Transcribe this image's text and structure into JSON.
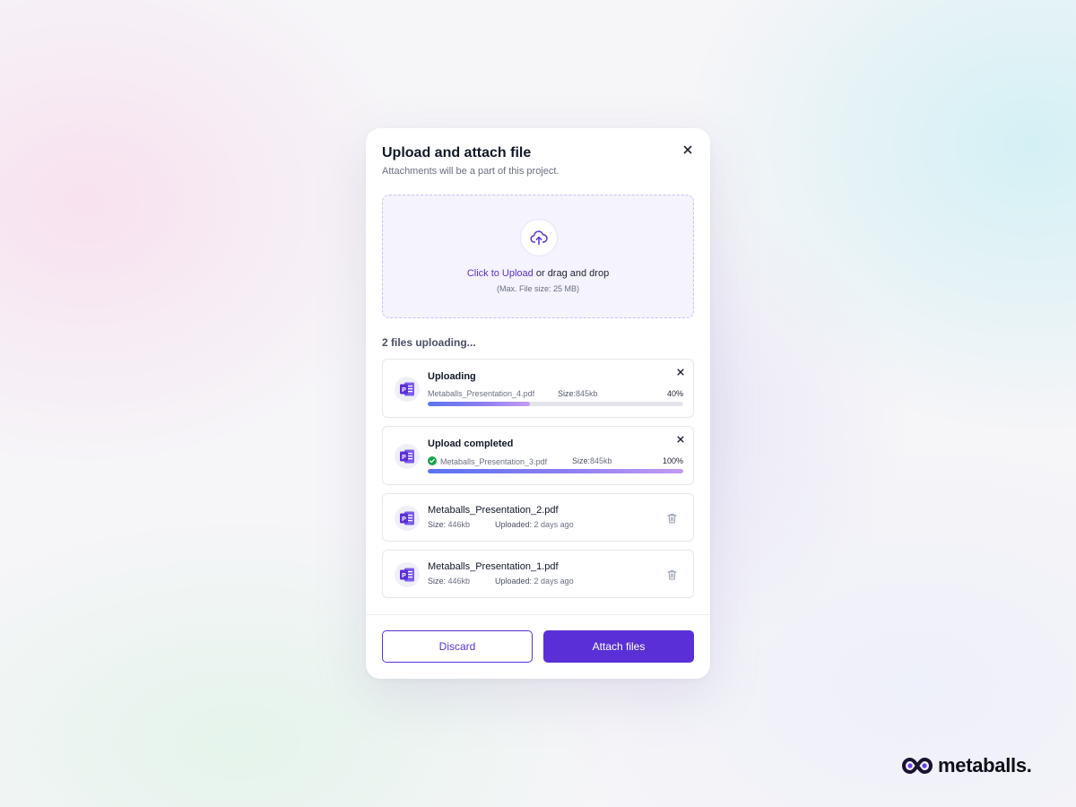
{
  "modal": {
    "title": "Upload and attach file",
    "subtitle": "Attachments will be a part of this project."
  },
  "dropzone": {
    "link_text": "Click to Upload",
    "rest_text": " or drag and drop",
    "hint": "(Max. File size: 25 MB)"
  },
  "status_heading": "2 files uploading...",
  "files": [
    {
      "title": "Uploading",
      "name": "Metaballs_Presentation_4.pdf",
      "size_label": "Size:",
      "size_value": "845kb",
      "progress_text": "40%",
      "progress": 0.4
    },
    {
      "title": "Upload completed",
      "name": "Metaballs_Presentation_3.pdf",
      "size_label": "Size:",
      "size_value": "845kb",
      "progress_text": "100%",
      "progress": 1.0
    },
    {
      "name": "Metaballs_Presentation_2.pdf",
      "size_label": "Size:",
      "size_value": " 446kb",
      "uploaded_label": "Uploaded:",
      "uploaded_value": " 2 days ago"
    },
    {
      "name": "Metaballs_Presentation_1.pdf",
      "size_label": "Size:",
      "size_value": " 446kb",
      "uploaded_label": "Uploaded:",
      "uploaded_value": " 2 days ago"
    }
  ],
  "buttons": {
    "discard": "Discard",
    "attach": "Attach files"
  },
  "brand": {
    "name": "metaballs."
  },
  "colors": {
    "accent": "#5a30d6",
    "progress_start": "#5b74f0",
    "progress_end": "#c39cf2",
    "success": "#16a34a"
  },
  "icons": [
    "close-icon",
    "cloud-upload-icon",
    "powerpoint-file-icon",
    "check-circle-icon",
    "trash-icon",
    "metaballs-logo-icon"
  ]
}
